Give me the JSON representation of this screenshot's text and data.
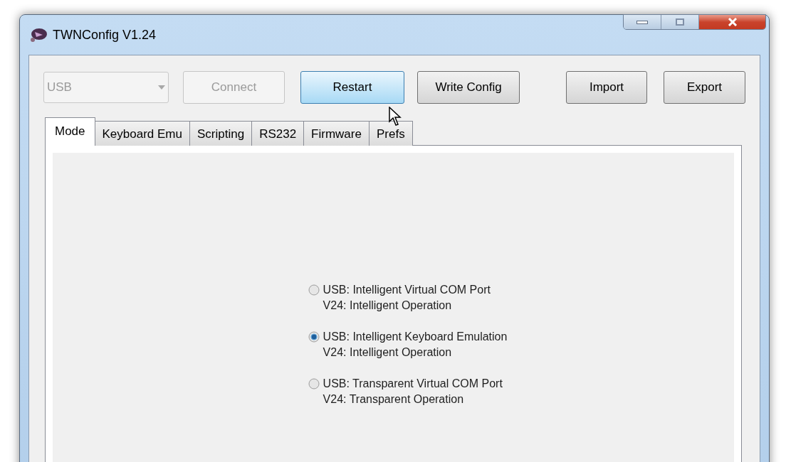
{
  "window": {
    "title": "TWNConfig V1.24"
  },
  "toolbar": {
    "port_select": {
      "value": "USB",
      "disabled": true
    },
    "buttons": [
      {
        "label": "Connect",
        "disabled": true,
        "hovered": false
      },
      {
        "label": "Restart",
        "disabled": false,
        "hovered": true
      },
      {
        "label": "Write Config",
        "disabled": false,
        "hovered": false
      },
      {
        "label": "Import",
        "disabled": false,
        "hovered": false
      },
      {
        "label": "Export",
        "disabled": false,
        "hovered": false
      }
    ]
  },
  "tabs": [
    {
      "label": "Mode",
      "selected": true
    },
    {
      "label": "Keyboard Emu",
      "selected": false
    },
    {
      "label": "Scripting",
      "selected": false
    },
    {
      "label": "RS232",
      "selected": false
    },
    {
      "label": "Firmware",
      "selected": false
    },
    {
      "label": "Prefs",
      "selected": false
    }
  ],
  "modes": [
    {
      "lines": [
        "USB: Intelligent Virtual COM Port",
        "V24: Intelligent Operation"
      ],
      "selected": false
    },
    {
      "lines": [
        "USB: Intelligent Keyboard Emulation",
        "V24: Intelligent Operation"
      ],
      "selected": true
    },
    {
      "lines": [
        "USB: Transparent Virtual COM Port",
        "V24: Transparent Operation"
      ],
      "selected": false
    }
  ]
}
